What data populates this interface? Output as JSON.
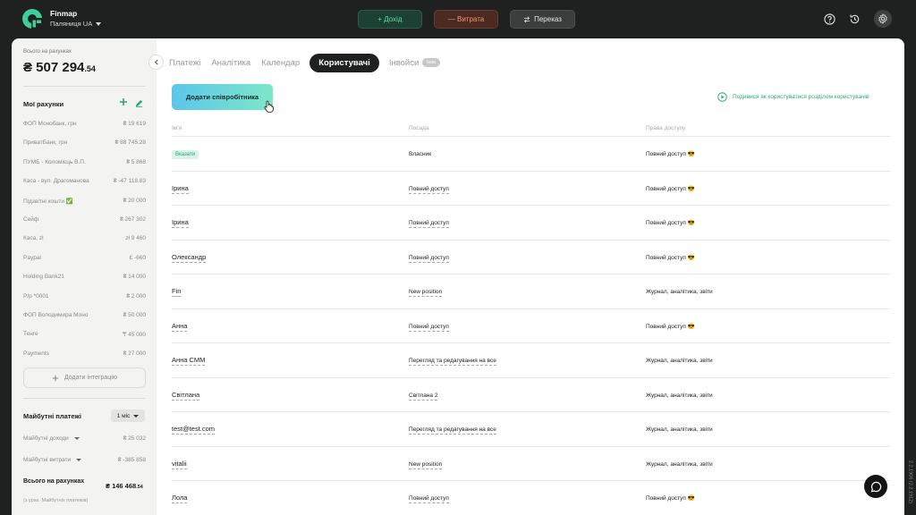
{
  "header": {
    "brand": "Finmap",
    "company": "Паляниця UA",
    "income_label": "+ Дохід",
    "expense_label": "— Витрата",
    "transfer_label": "Переказ"
  },
  "sidebar": {
    "total_label": "Всього на рахунках",
    "total_main": "₴ 507 294",
    "total_cents": ".54",
    "accounts_title": "Мої рахунки",
    "accounts": [
      {
        "name": "ФОП Монобанк, грн",
        "value": "₴ 19 619"
      },
      {
        "name": "ПриватБанк, грн",
        "value": "₴ 88 745.28"
      },
      {
        "name": "ПУМБ - Коломієць В.П.",
        "value": "₴ 5 868"
      },
      {
        "name": "Каса - вул. Драгоманова",
        "value": "₴ -47 118.83"
      },
      {
        "name": "Підзвітні кошти ✅",
        "value": "₴ 20 000"
      },
      {
        "name": "Сейф",
        "value": "₴ 267 302"
      },
      {
        "name": "Каса, zl",
        "value": "zł 9 460"
      },
      {
        "name": "Paypal",
        "value": "£ -660"
      },
      {
        "name": "Holding Bank21",
        "value": "₴ 14 000"
      },
      {
        "name": "Р/р *0001",
        "value": "₴ 2 000"
      },
      {
        "name": "ФОП Володимира Моно",
        "value": "₴ 50 000"
      },
      {
        "name": "Тенге",
        "value": "₸ 45 000"
      },
      {
        "name": "Payments",
        "value": "₴ 27 000"
      }
    ],
    "add_integration": "Додати інтеграцію",
    "future_title": "Майбутні платежі",
    "period": "1 міс",
    "future_income_label": "Майбутні доходи",
    "future_income_value": "₴ 25 032",
    "future_expense_label": "Майбутні витрати",
    "future_expense_value": "₴ -385 858",
    "balance_label": "Всього на рахунках",
    "balance_sub": "(з урах. Майбутніх платежів)",
    "balance_main": "₴ 146 468",
    "balance_cents": ".54"
  },
  "tabs": [
    {
      "label": "Платежі"
    },
    {
      "label": "Аналітика"
    },
    {
      "label": "Календар"
    },
    {
      "label": "Користувачі"
    },
    {
      "label": "Інвойси",
      "badge": "beta"
    }
  ],
  "main": {
    "add_employee": "Додати співробітника",
    "guide_link": "Подивися як користуватися розділом користувачів",
    "columns": [
      "Ім'я",
      "Посада",
      "Права доступу"
    ],
    "rows": [
      {
        "name": "Вказати",
        "position": "Власник",
        "rights": "Повний доступ 😎"
      },
      {
        "name": "Ірина",
        "position": "Повний доступ",
        "rights": "Повний доступ 😎"
      },
      {
        "name": "Ірина",
        "position": "Повний доступ",
        "rights": "Повний доступ 😎"
      },
      {
        "name": "Олександр",
        "position": "Повний доступ",
        "rights": "Повний доступ 😎"
      },
      {
        "name": "Fin",
        "position": "New position",
        "rights": "Журнал, аналітика, звіти"
      },
      {
        "name": "Анна",
        "position": "Повний доступ",
        "rights": "Повний доступ 😎"
      },
      {
        "name": "Анна СММ",
        "position": "Перегляд та редагування на все",
        "rights": "Журнал, аналітика, звіти"
      },
      {
        "name": "Світлана",
        "position": "Світлана 2",
        "rights": "Журнал, аналітика, звіти"
      },
      {
        "name": "test@test.com",
        "position": "Перегляд та редагування на все",
        "rights": "Журнал, аналітика, звіти"
      },
      {
        "name": "vitalii",
        "position": "New position",
        "rights": "Журнал, аналітика, звіти"
      },
      {
        "name": "Лола",
        "position": "Повний доступ",
        "rights": "Повний доступ 😎"
      }
    ]
  },
  "version": "2.2.1906 (2.2.1912)",
  "colors": {
    "accent": "#2fa874",
    "income": "#5fdc9b",
    "expense": "#f3956d"
  }
}
